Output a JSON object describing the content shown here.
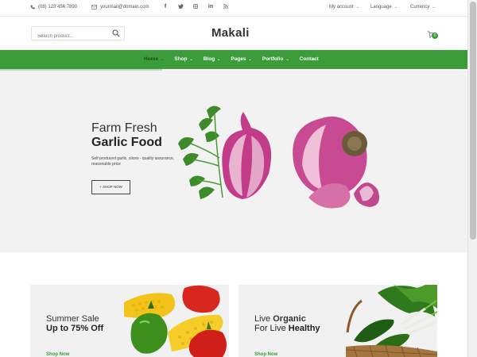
{
  "topbar": {
    "phone": "(08) 123 456 7890",
    "email": "yourmail@domain.com",
    "socials": [
      "f",
      "t",
      "ig",
      "in",
      "rss"
    ],
    "account": "My account",
    "language": "Language",
    "currency": "Currency"
  },
  "header": {
    "search_placeholder": "Search product...",
    "logo": "Makali",
    "cart_count": "0"
  },
  "nav": {
    "items": [
      "Home",
      "Shop",
      "Blog",
      "Pages",
      "Portfolio",
      "Contact"
    ]
  },
  "hero": {
    "line1": "Farm Fresh",
    "line2": "Garlic Food",
    "description": "Self produced garlic, slices - quality assurance, reasonable price",
    "button": "+ SHOP NOW"
  },
  "banners": [
    {
      "line1": "Summer Sale",
      "line2": "Up to 75% Off",
      "link": "Shop Now"
    },
    {
      "line1_a": "Live ",
      "line1_b": "Organic",
      "line2_a": "For Live ",
      "line2_b": "Healthy",
      "link": "Shop Now"
    }
  ],
  "colors": {
    "accent": "#3a9d3a",
    "hero_bg": "#f2f2f2",
    "banner_bg": "#f1f1f1"
  }
}
